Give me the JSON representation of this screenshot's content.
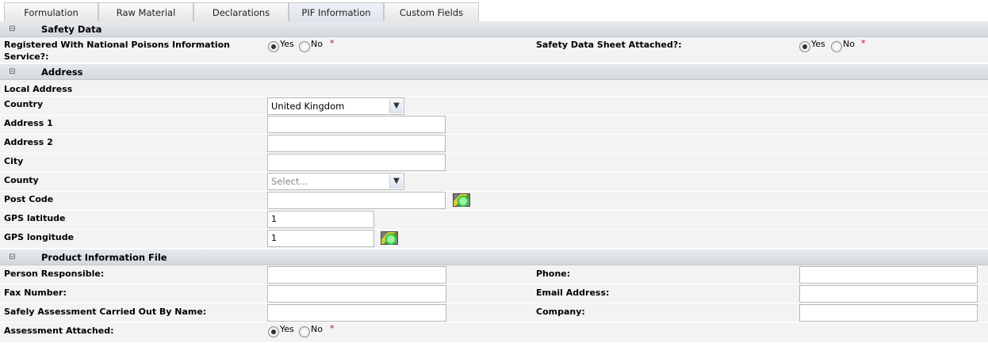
{
  "tabs": [
    "Formulation",
    "Raw Material",
    "Declarations",
    "PIF Information",
    "Custom Fields"
  ],
  "active_tab": "PIF Information",
  "toggle_icon": "⊟",
  "safety": {
    "title": "Safety Data",
    "npis_label_line1": "Registered With National Poisons Information",
    "npis_label_line2": "Service?:",
    "sds_label": "Safety Data Sheet Attached?:",
    "yes": "Yes",
    "no": "No",
    "required": "*",
    "npis_value": "Yes",
    "sds_value": "Yes"
  },
  "address": {
    "title": "Address",
    "local_address_label": "Local Address",
    "country_label": "Country",
    "country_value": "United Kingdom",
    "address1_label": "Address 1",
    "address1_value": "",
    "address2_label": "Address 2",
    "address2_value": "",
    "city_label": "City",
    "city_value": "",
    "county_label": "County",
    "county_placeholder": "Select...",
    "postcode_label": "Post Code",
    "postcode_value": "",
    "lat_label": "GPS latitude",
    "lat_value": "1",
    "lon_label": "GPS longitude",
    "lon_value": "1"
  },
  "pif": {
    "title": "Product Information File",
    "person_label": "Person Responsible:",
    "phone_label": "Phone:",
    "fax_label": "Fax Number:",
    "email_label": "Email Address:",
    "assessor_label": "Safely Assessment Carried Out By Name:",
    "company_label": "Company:",
    "assessment_label": "Assessment Attached:",
    "assessment_value": "Yes",
    "yes": "Yes",
    "no": "No",
    "required": "*"
  }
}
